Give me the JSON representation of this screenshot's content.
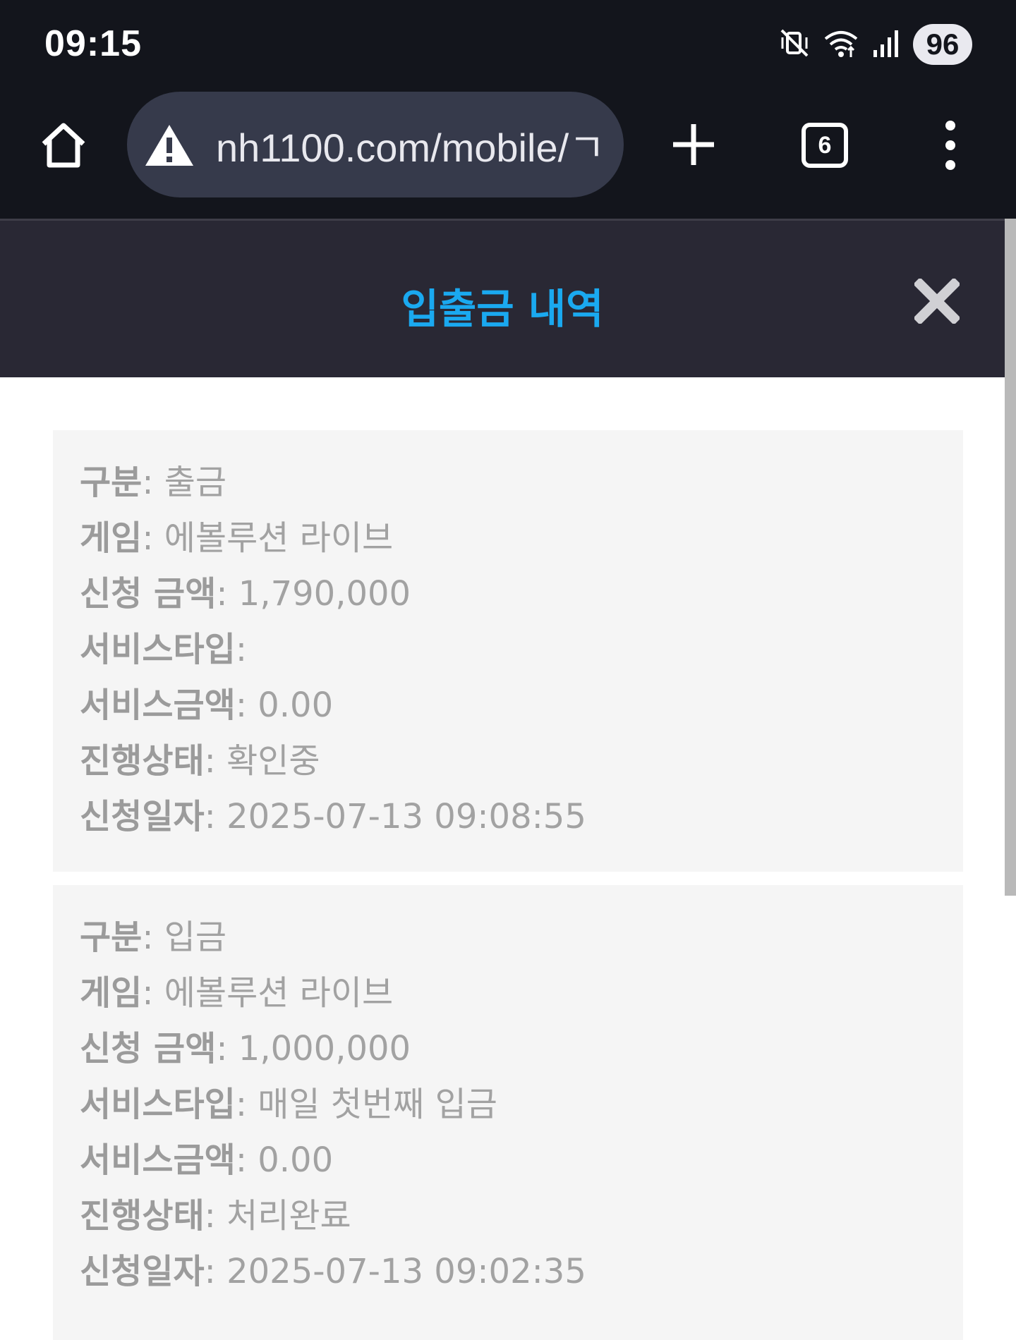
{
  "status_bar": {
    "time": "09:15",
    "battery": "96",
    "icons": [
      "mute-vibrate-icon",
      "wifi-icon",
      "signal-icon"
    ]
  },
  "browser": {
    "url": "nh1100.com/mobile/ㄱ",
    "tab_count": "6",
    "icons": [
      "home-icon",
      "warning-icon",
      "new-tab-icon",
      "tabs-icon",
      "more-menu-icon"
    ]
  },
  "modal": {
    "title": "입출금 내역",
    "title_color": "#1aa9f0",
    "close_icon": "close-icon"
  },
  "transactions": [
    {
      "type_label": "구분",
      "type": "출금",
      "game_label": "게임",
      "game": "에볼루션 라이브",
      "amount_label": "신청 금액",
      "amount": "1,790,000",
      "service_type_label": "서비스타입",
      "service_type": "",
      "service_amount_label": "서비스금액",
      "service_amount": "0.00",
      "status_label": "진행상태",
      "status": "확인중",
      "date_label": "신청일자",
      "date": "2025-07-13 09:08:55"
    },
    {
      "type_label": "구분",
      "type": "입금",
      "game_label": "게임",
      "game": "에볼루션 라이브",
      "amount_label": "신청 금액",
      "amount": "1,000,000",
      "service_type_label": "서비스타입",
      "service_type": "매일 첫번째 입금",
      "service_amount_label": "서비스금액",
      "service_amount": "0.00",
      "status_label": "진행상태",
      "status": "처리완료",
      "date_label": "신청일자",
      "date": "2025-07-13 09:02:35"
    }
  ]
}
